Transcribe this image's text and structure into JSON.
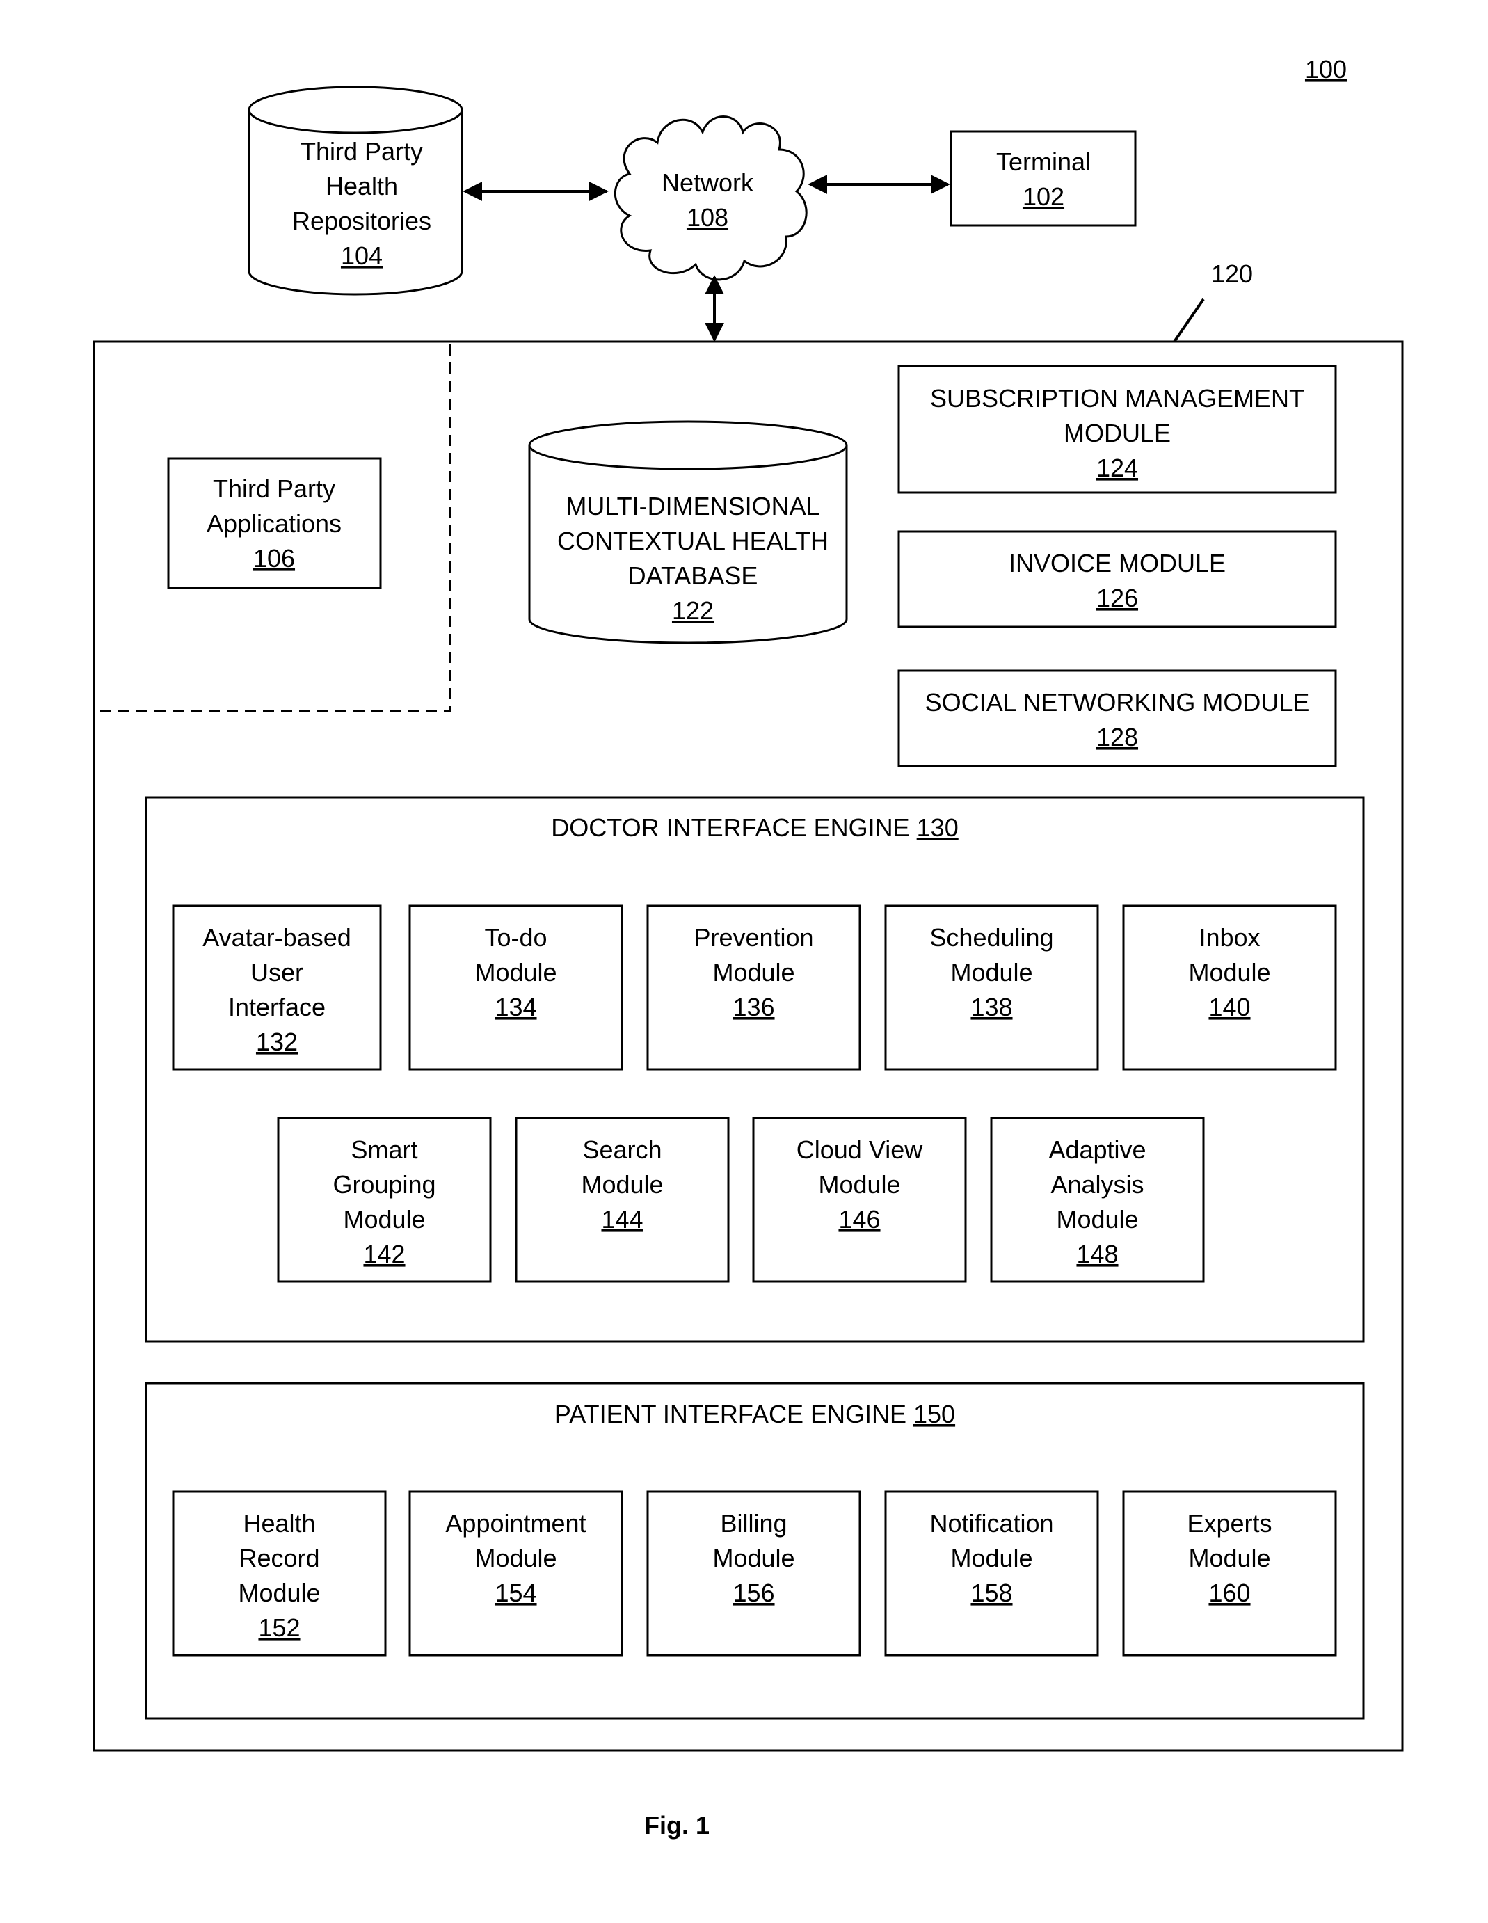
{
  "figure": {
    "reference": "100",
    "caption": "Fig. 1",
    "system_reference": "120"
  },
  "external": {
    "repositories": {
      "lines": [
        "Third Party",
        "Health",
        "Repositories"
      ],
      "ref": "104"
    },
    "network": {
      "lines": [
        "Network"
      ],
      "ref": "108"
    },
    "terminal": {
      "lines": [
        "Terminal"
      ],
      "ref": "102"
    },
    "third_party_apps": {
      "lines": [
        "Third Party",
        "Applications"
      ],
      "ref": "106"
    }
  },
  "system": {
    "database": {
      "lines": [
        "MULTI-DIMENSIONAL",
        "CONTEXTUAL HEALTH",
        "DATABASE"
      ],
      "ref": "122"
    },
    "subscription": {
      "lines": [
        "SUBSCRIPTION MANAGEMENT",
        "MODULE"
      ],
      "ref": "124"
    },
    "invoice": {
      "lines": [
        "INVOICE MODULE"
      ],
      "ref": "126"
    },
    "social": {
      "lines": [
        "SOCIAL NETWORKING MODULE"
      ],
      "ref": "128"
    },
    "doctor_engine": {
      "title": "DOCTOR INTERFACE ENGINE",
      "ref": "130",
      "modules": [
        {
          "lines": [
            "Avatar-based",
            "User",
            "Interface"
          ],
          "ref": "132"
        },
        {
          "lines": [
            "To-do",
            "Module"
          ],
          "ref": "134"
        },
        {
          "lines": [
            "Prevention",
            "Module"
          ],
          "ref": "136"
        },
        {
          "lines": [
            "Scheduling",
            "Module"
          ],
          "ref": "138"
        },
        {
          "lines": [
            "Inbox",
            "Module"
          ],
          "ref": "140"
        },
        {
          "lines": [
            "Smart",
            "Grouping",
            "Module"
          ],
          "ref": "142"
        },
        {
          "lines": [
            "Search",
            "Module"
          ],
          "ref": "144"
        },
        {
          "lines": [
            "Cloud View",
            "Module"
          ],
          "ref": "146"
        },
        {
          "lines": [
            "Adaptive",
            "Analysis",
            "Module"
          ],
          "ref": "148"
        }
      ]
    },
    "patient_engine": {
      "title": "PATIENT INTERFACE ENGINE",
      "ref": "150",
      "modules": [
        {
          "lines": [
            "Health",
            "Record",
            "Module"
          ],
          "ref": "152"
        },
        {
          "lines": [
            "Appointment",
            "Module"
          ],
          "ref": "154"
        },
        {
          "lines": [
            "Billing",
            "Module"
          ],
          "ref": "156"
        },
        {
          "lines": [
            "Notification",
            "Module"
          ],
          "ref": "158"
        },
        {
          "lines": [
            "Experts",
            "Module"
          ],
          "ref": "160"
        }
      ]
    }
  }
}
